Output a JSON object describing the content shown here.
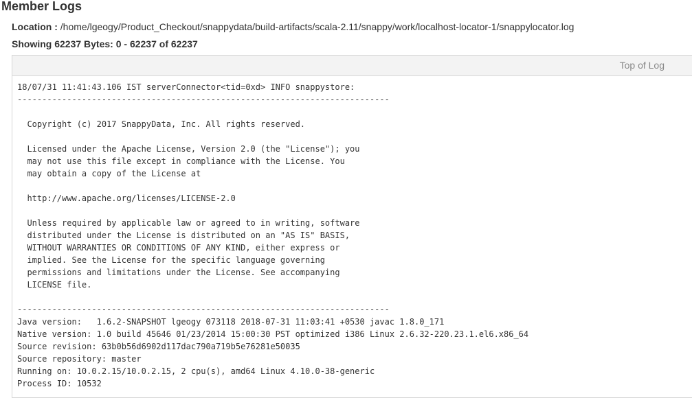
{
  "page": {
    "title": "Member Logs"
  },
  "location": {
    "label": "Location :",
    "path": "/home/lgeogy/Product_Checkout/snappydata/build-artifacts/scala-2.11/snappy/work/localhost-locator-1/snappylocator.log"
  },
  "showing": {
    "text": "Showing 62237 Bytes: 0 - 62237 of 62237"
  },
  "log_panel": {
    "top_link_label": "Top of Log",
    "lines": [
      "18/07/31 11:41:43.106 IST serverConnector<tid=0xd> INFO snappystore:",
      "---------------------------------------------------------------------------",
      "",
      "  Copyright (c) 2017 SnappyData, Inc. All rights reserved.",
      "",
      "  Licensed under the Apache License, Version 2.0 (the \"License\"); you",
      "  may not use this file except in compliance with the License. You",
      "  may obtain a copy of the License at",
      "",
      "  http://www.apache.org/licenses/LICENSE-2.0",
      "",
      "  Unless required by applicable law or agreed to in writing, software",
      "  distributed under the License is distributed on an \"AS IS\" BASIS,",
      "  WITHOUT WARRANTIES OR CONDITIONS OF ANY KIND, either express or",
      "  implied. See the License for the specific language governing",
      "  permissions and limitations under the License. See accompanying",
      "  LICENSE file.",
      "",
      "---------------------------------------------------------------------------",
      "Java version:   1.6.2-SNAPSHOT lgeogy 073118 2018-07-31 11:03:41 +0530 javac 1.8.0_171",
      "Native version: 1.0 build 45646 01/23/2014 15:00:30 PST optimized i386 Linux 2.6.32-220.23.1.el6.x86_64",
      "Source revision: 63b0b56d6902d117dac790a719b5e76281e50035",
      "Source repository: master",
      "Running on: 10.0.2.15/10.0.2.15, 2 cpu(s), amd64 Linux 4.10.0-38-generic",
      "Process ID: 10532"
    ]
  }
}
